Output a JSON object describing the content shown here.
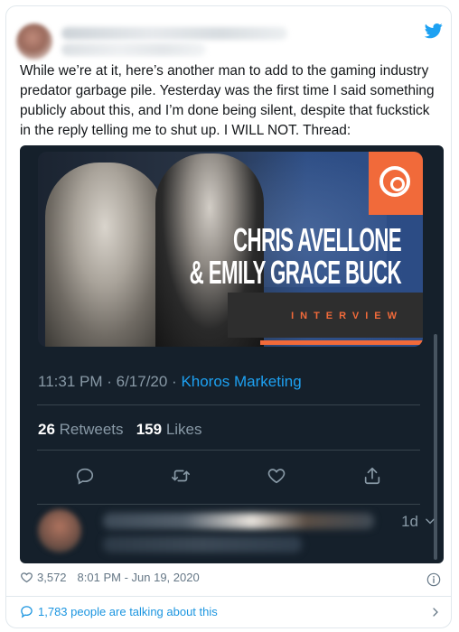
{
  "tweet": {
    "text": "While we’re at it, here’s another man to add to the gaming industry predator garbage pile. Yesterday was the first time I said something publicly about this, and I’m done being silent, despite that fuckstick in the reply telling me to shut up. I WILL NOT. Thread:",
    "likes": "3,572",
    "timestamp": "8:01 PM - Jun 19, 2020",
    "talking": "1,783 people are talking about this"
  },
  "embed": {
    "media_title_line1": "CHRIS AVELLONE",
    "media_title_line2": "& EMILY GRACE BUCK",
    "media_tag": "INTERVIEW",
    "time": "11:31 PM · 6/17/20 · ",
    "source": "Khoros Marketing",
    "retweets_count": "26",
    "retweets_label": "Retweets",
    "likes_count": "159",
    "likes_label": "Likes",
    "reply_time": "1d"
  },
  "colors": {
    "twitter_blue": "#1da1f2",
    "embed_bg": "#15202b",
    "accent_orange": "#f16a3a"
  }
}
